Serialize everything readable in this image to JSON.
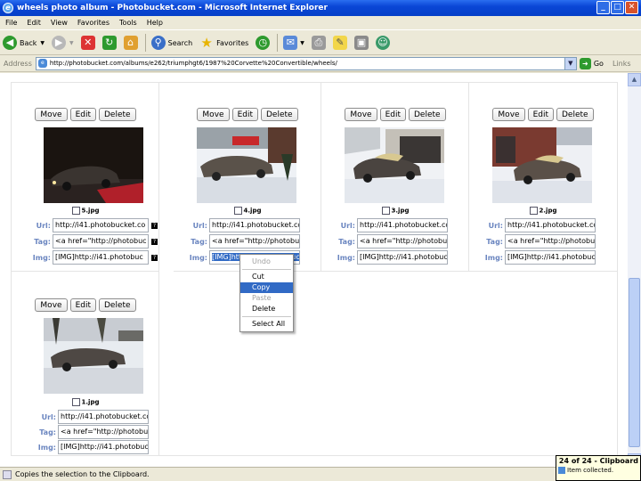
{
  "window": {
    "title": "wheels photo album - Photobucket.com - Microsoft Internet Explorer"
  },
  "menu": [
    "File",
    "Edit",
    "View",
    "Favorites",
    "Tools",
    "Help"
  ],
  "toolbar": {
    "back": "Back",
    "search": "Search",
    "favorites": "Favorites"
  },
  "address": {
    "label": "Address",
    "url": "http://photobucket.com/albums/e262/triumphgt6/1987%20Corvette%20Convertible/wheels/",
    "go": "Go",
    "links": "Links"
  },
  "photo_buttons": {
    "move": "Move",
    "edit": "Edit",
    "delete": "Delete"
  },
  "field_labels": {
    "url": "Url:",
    "tag": "Tag:",
    "img": "Img:"
  },
  "photos": [
    {
      "filename": "5.jpg",
      "url": "http://i41.photobucket.co",
      "tag": "<a href=\"http://photobuc",
      "img": "[IMG]http://i41.photobuc",
      "help": "?"
    },
    {
      "filename": "4.jpg",
      "url": "http://i41.photobucket.co",
      "tag": "<a href=\"http://photobu",
      "img": "[IMG]http://i41.photobuc",
      "help": "?"
    },
    {
      "filename": "3.jpg",
      "url": "http://i41.photobucket.co",
      "tag": "<a href=\"http://photobuc",
      "img": "[IMG]http://i41.photobuc",
      "help": "?"
    },
    {
      "filename": "2.jpg",
      "url": "http://i41.photobucket.co",
      "tag": "<a href=\"http://photobuc",
      "img": "[IMG]http://i41.photobuc",
      "help": "?"
    },
    {
      "filename": "1.jpg",
      "url": "http://i41.photobucket.co",
      "tag": "<a href=\"http://photobuc",
      "img": "[IMG]http://i41.photobuc",
      "help": "?"
    }
  ],
  "context_menu": {
    "undo": "Undo",
    "cut": "Cut",
    "copy": "Copy",
    "paste": "Paste",
    "delete": "Delete",
    "select_all": "Select All"
  },
  "status": {
    "text": "Copies the selection to the Clipboard."
  },
  "clipboard": {
    "title": "24 of 24 - Clipboard",
    "item": "Item collected."
  }
}
